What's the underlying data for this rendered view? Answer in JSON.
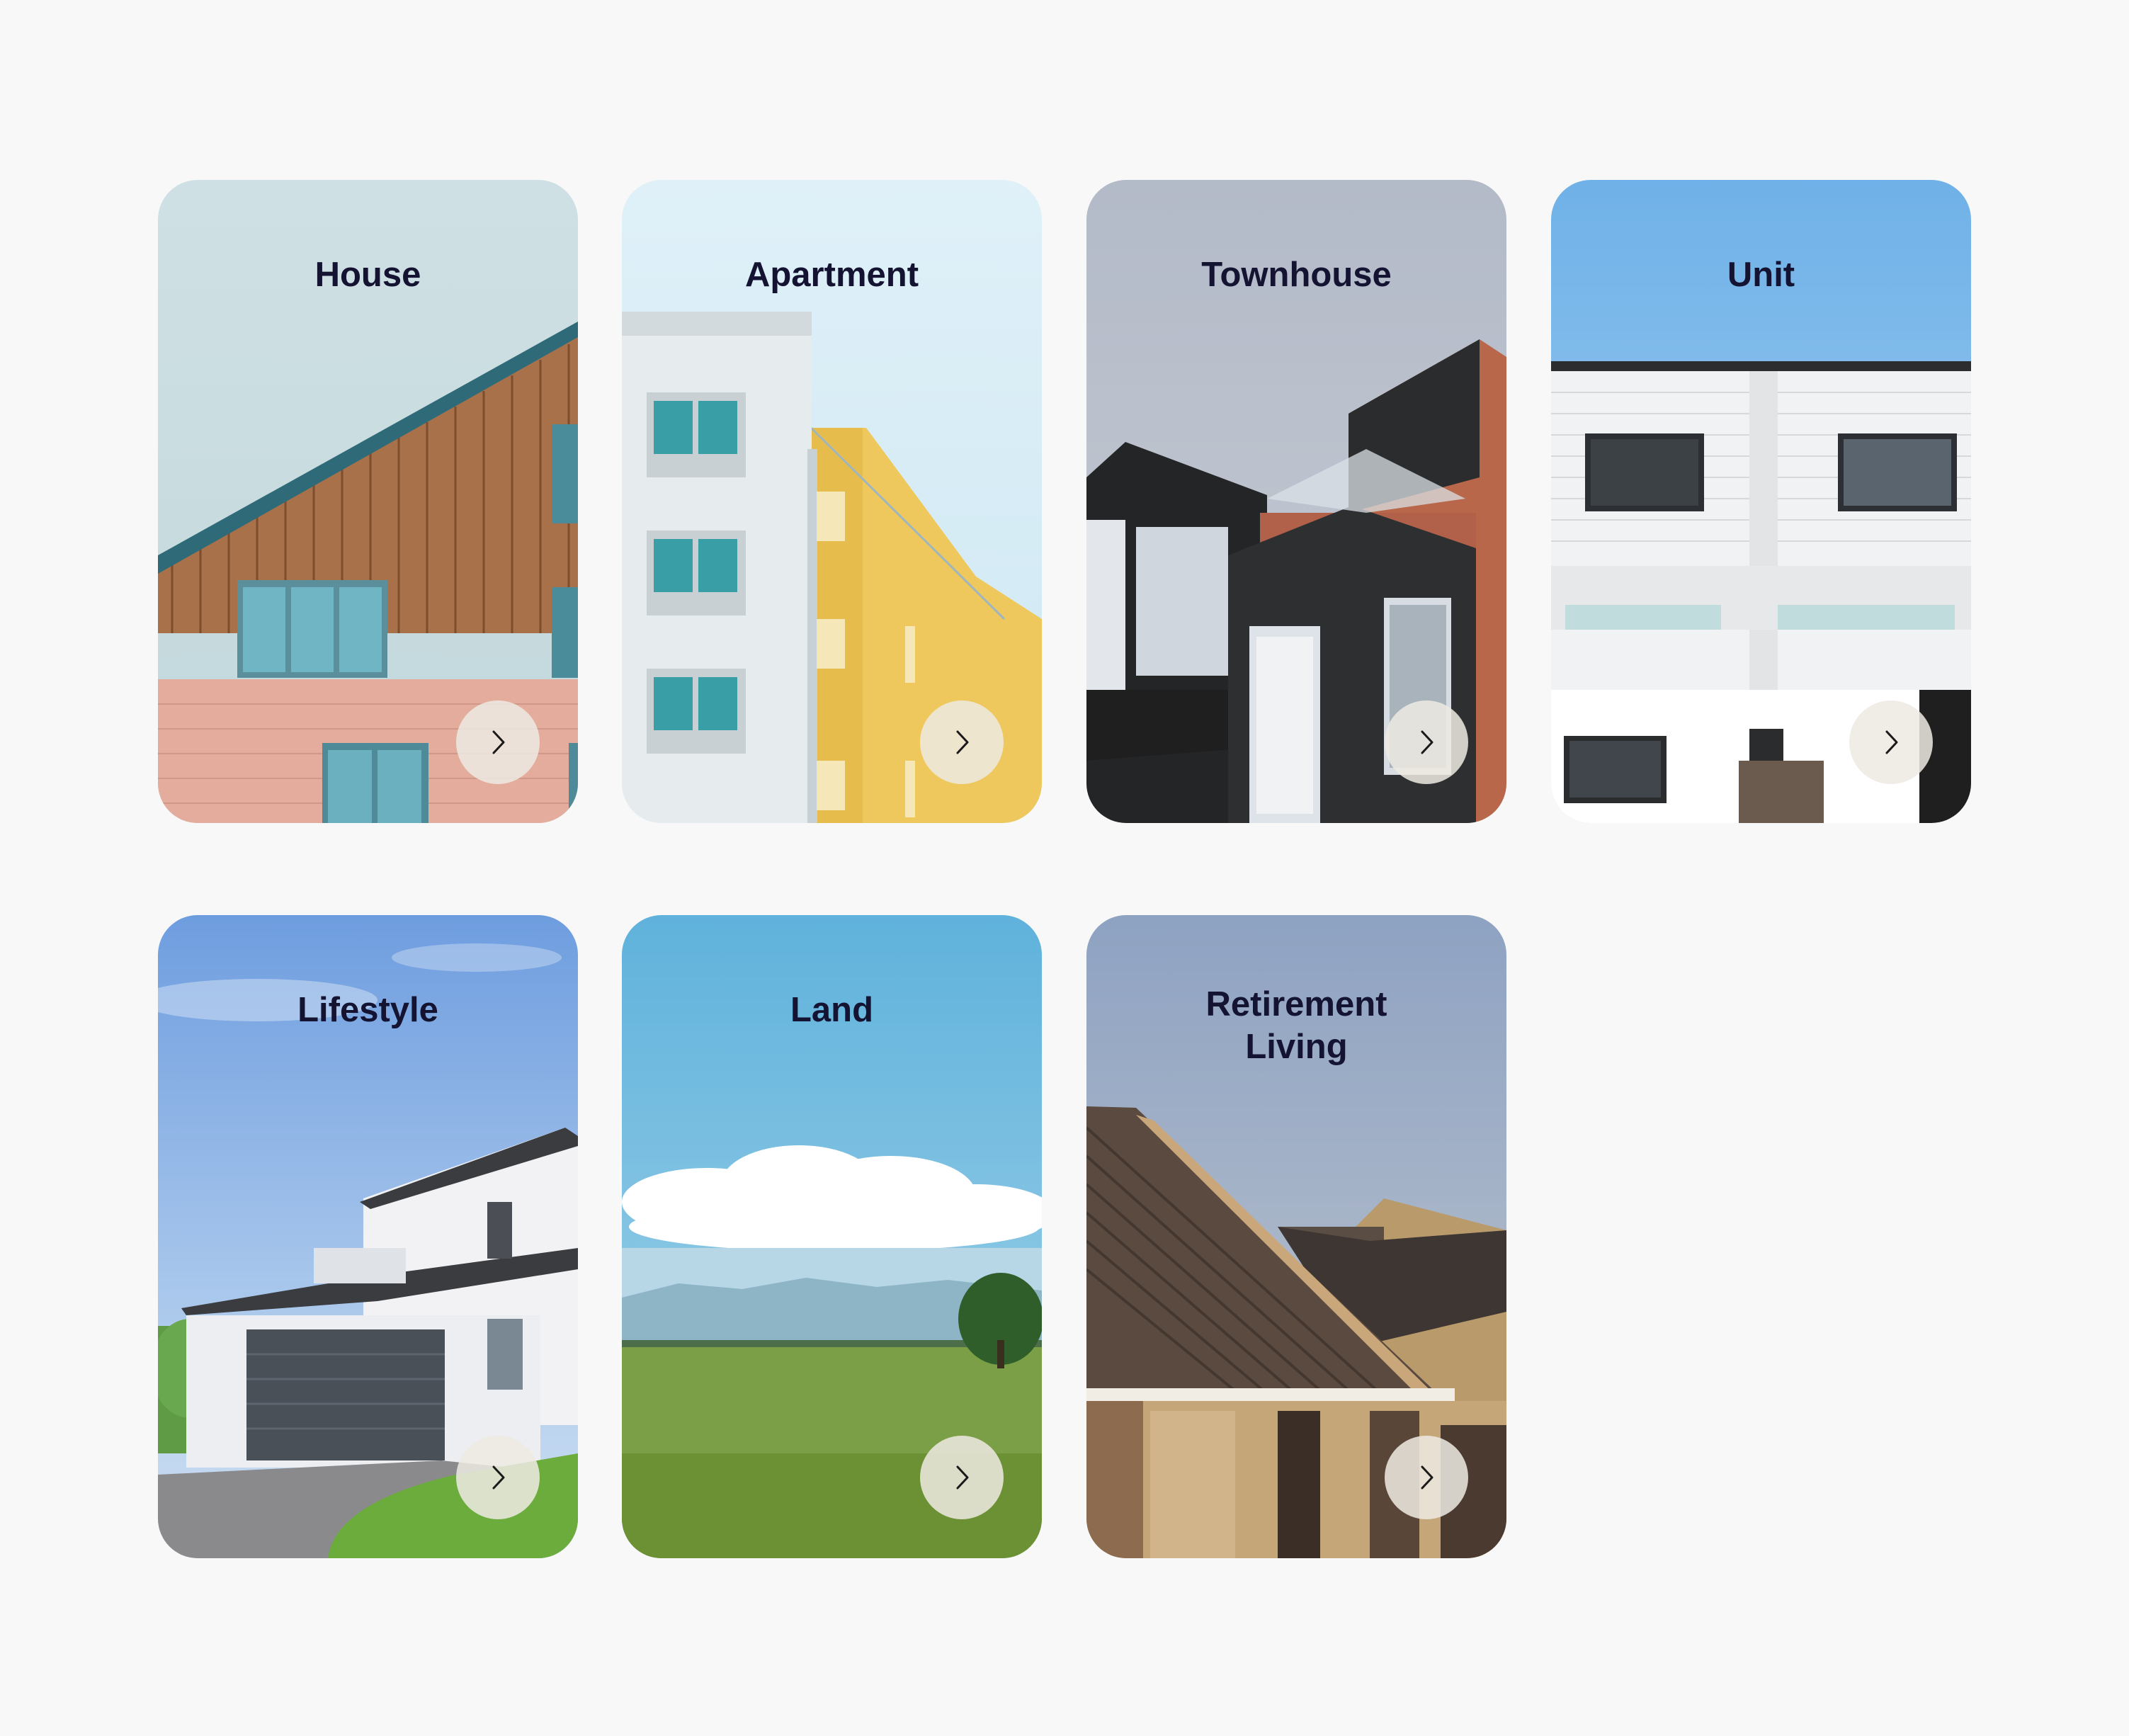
{
  "categories": [
    {
      "label": "House"
    },
    {
      "label": "Apartment"
    },
    {
      "label": "Townhouse"
    },
    {
      "label": "Unit"
    },
    {
      "label": "Lifestyle"
    },
    {
      "label": "Land"
    },
    {
      "label": "Retirement Living"
    }
  ],
  "icons": {
    "card_arrow": "chevron-right-icon"
  },
  "colors": {
    "page_background": "#f8f8f9",
    "title_text": "#141432",
    "arrow_button": "#eeeae2"
  }
}
